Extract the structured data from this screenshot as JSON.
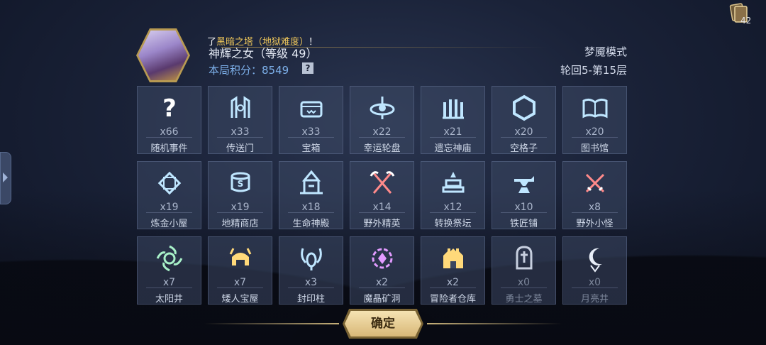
{
  "deck": {
    "count": "42"
  },
  "header": {
    "marquee_prefix": "了",
    "marquee_highlight": "黑暗之塔（地狱难度）",
    "marquee_suffix": "！",
    "hero_name": "神辉之女（等级 49）",
    "score_label": "本局积分：",
    "score_value": "8549",
    "help": "?",
    "mode": "梦魇模式",
    "round": "轮回5-第15层"
  },
  "grid": [
    {
      "count": "x66",
      "name": "随机事件",
      "icon": "question-icon",
      "color": "#ffffff",
      "dim": false
    },
    {
      "count": "x33",
      "name": "传送门",
      "icon": "portal-icon",
      "color": "#bfe6ff",
      "dim": false
    },
    {
      "count": "x33",
      "name": "宝箱",
      "icon": "chest-icon",
      "color": "#bfe6ff",
      "dim": false
    },
    {
      "count": "x22",
      "name": "幸运轮盘",
      "icon": "wheel-icon",
      "color": "#bfe6ff",
      "dim": false
    },
    {
      "count": "x21",
      "name": "遗忘神庙",
      "icon": "temple-icon",
      "color": "#bfe6ff",
      "dim": false
    },
    {
      "count": "x20",
      "name": "空格子",
      "icon": "hexagon-icon",
      "color": "#bfe6ff",
      "dim": false
    },
    {
      "count": "x20",
      "name": "图书馆",
      "icon": "book-icon",
      "color": "#bfe6ff",
      "dim": false
    },
    {
      "count": "x19",
      "name": "炼金小屋",
      "icon": "alchemy-icon",
      "color": "#bfe6ff",
      "dim": false
    },
    {
      "count": "x19",
      "name": "地精商店",
      "icon": "shop-icon",
      "color": "#bfe6ff",
      "dim": false
    },
    {
      "count": "x18",
      "name": "生命神殿",
      "icon": "shrine-icon",
      "color": "#bfe6ff",
      "dim": false
    },
    {
      "count": "x14",
      "name": "野外精英",
      "icon": "crossed-axes-icon",
      "color": "#ff8a8a",
      "dim": false
    },
    {
      "count": "x12",
      "name": "转换祭坛",
      "icon": "altar-icon",
      "color": "#bfe6ff",
      "dim": false
    },
    {
      "count": "x10",
      "name": "铁匠铺",
      "icon": "anvil-icon",
      "color": "#bfe6ff",
      "dim": false
    },
    {
      "count": "x8",
      "name": "野外小怪",
      "icon": "crossed-swords-icon",
      "color": "#ff8a8a",
      "dim": false
    },
    {
      "count": "x7",
      "name": "太阳井",
      "icon": "sun-icon",
      "color": "#a8f0c8",
      "dim": false
    },
    {
      "count": "x7",
      "name": "矮人宝屋",
      "icon": "helmet-icon",
      "color": "#ffd97a",
      "dim": false
    },
    {
      "count": "x3",
      "name": "封印柱",
      "icon": "seal-pillar-icon",
      "color": "#bfe6ff",
      "dim": false
    },
    {
      "count": "x2",
      "name": "魔晶矿洞",
      "icon": "crystal-mine-icon",
      "color": "#e29bff",
      "dim": false
    },
    {
      "count": "x2",
      "name": "冒险者仓库",
      "icon": "warehouse-icon",
      "color": "#ffd97a",
      "dim": false
    },
    {
      "count": "x0",
      "name": "勇士之墓",
      "icon": "tomb-icon",
      "color": "#c7cfdf",
      "dim": true
    },
    {
      "count": "x0",
      "name": "月亮井",
      "icon": "moon-icon",
      "color": "#e8eef8",
      "dim": true
    }
  ],
  "confirm_label": "确定"
}
